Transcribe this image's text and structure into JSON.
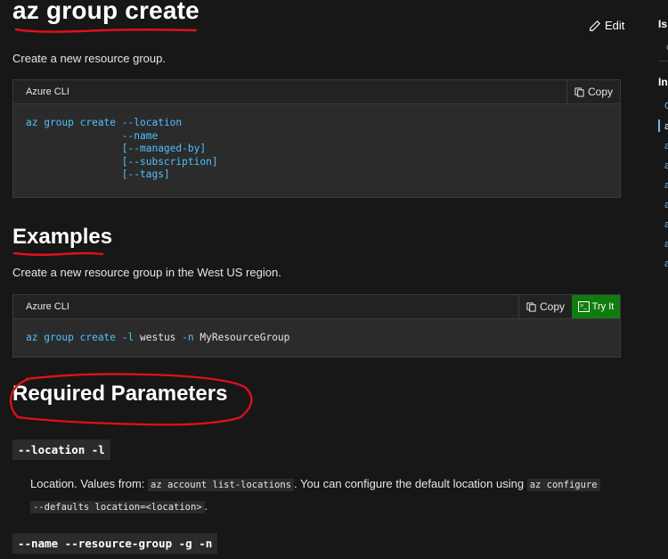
{
  "page": {
    "title": "az group create",
    "edit_label": "Edit",
    "description": "Create a new resource group."
  },
  "syntax_block": {
    "language": "Azure CLI",
    "copy_label": "Copy",
    "lines": [
      [
        "az group create",
        "--location"
      ],
      [
        "",
        "--name"
      ],
      [
        "",
        "[--managed-by]"
      ],
      [
        "",
        "[--subscription]"
      ],
      [
        "",
        "[--tags]"
      ]
    ]
  },
  "examples": {
    "heading": "Examples",
    "description": "Create a new resource group in the West US region.",
    "language": "Azure CLI",
    "copy_label": "Copy",
    "try_label": "Try It",
    "command_parts": [
      "az group create ",
      "-l",
      " westus ",
      "-n",
      " MyResourceGroup"
    ]
  },
  "required": {
    "heading": "Required Parameters",
    "location_param": "--location -l",
    "location_desc_1": "Location. Values from: ",
    "location_code_1": "az account list-locations",
    "location_desc_2": ". You can configure the default location using ",
    "location_code_2a": "az configure",
    "location_code_2b": "--defaults location=<location>",
    "location_desc_3": ".",
    "name_param": "--name --resource-group -g -n"
  },
  "sidebar": {
    "heading_1": "Is",
    "heading_1_item": "e",
    "heading_2": "In",
    "items": [
      "C",
      "a",
      "a",
      "a",
      "a",
      "a",
      "a",
      "a",
      "a"
    ]
  },
  "colors": {
    "background": "#171717",
    "code_bg": "#2b2b2b",
    "link_blue": "#4fc1ff",
    "try_green": "#107c10",
    "annotation_red": "#e0101a"
  }
}
